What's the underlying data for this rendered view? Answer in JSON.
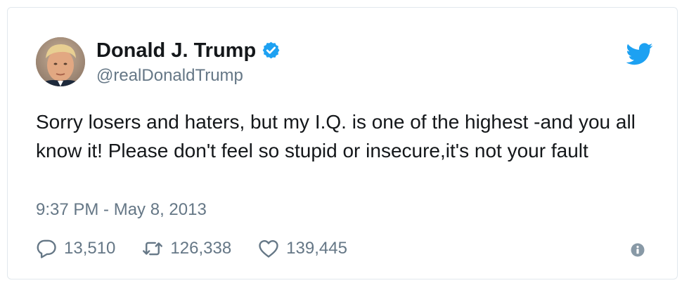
{
  "tweet": {
    "author": {
      "display_name": "Donald J. Trump",
      "handle": "@realDonaldTrump",
      "verified": true
    },
    "text": "Sorry losers and haters, but my I.Q. is one of the highest -and you all know it! Please don't feel so stupid or insecure,it's not your fault",
    "timestamp": "9:37 PM - May 8, 2013",
    "stats": {
      "replies": "13,510",
      "retweets": "126,338",
      "likes": "139,445"
    }
  },
  "icons": {
    "avatar": "avatar-photo",
    "verified": "verified-badge-icon",
    "brand": "twitter-bird-icon",
    "reply": "reply-icon",
    "retweet": "retweet-icon",
    "like": "heart-icon",
    "info": "info-icon"
  },
  "colors": {
    "brand": "#1da1f2",
    "text": "#14171a",
    "secondary": "#657786",
    "border": "#e1e8ed"
  }
}
